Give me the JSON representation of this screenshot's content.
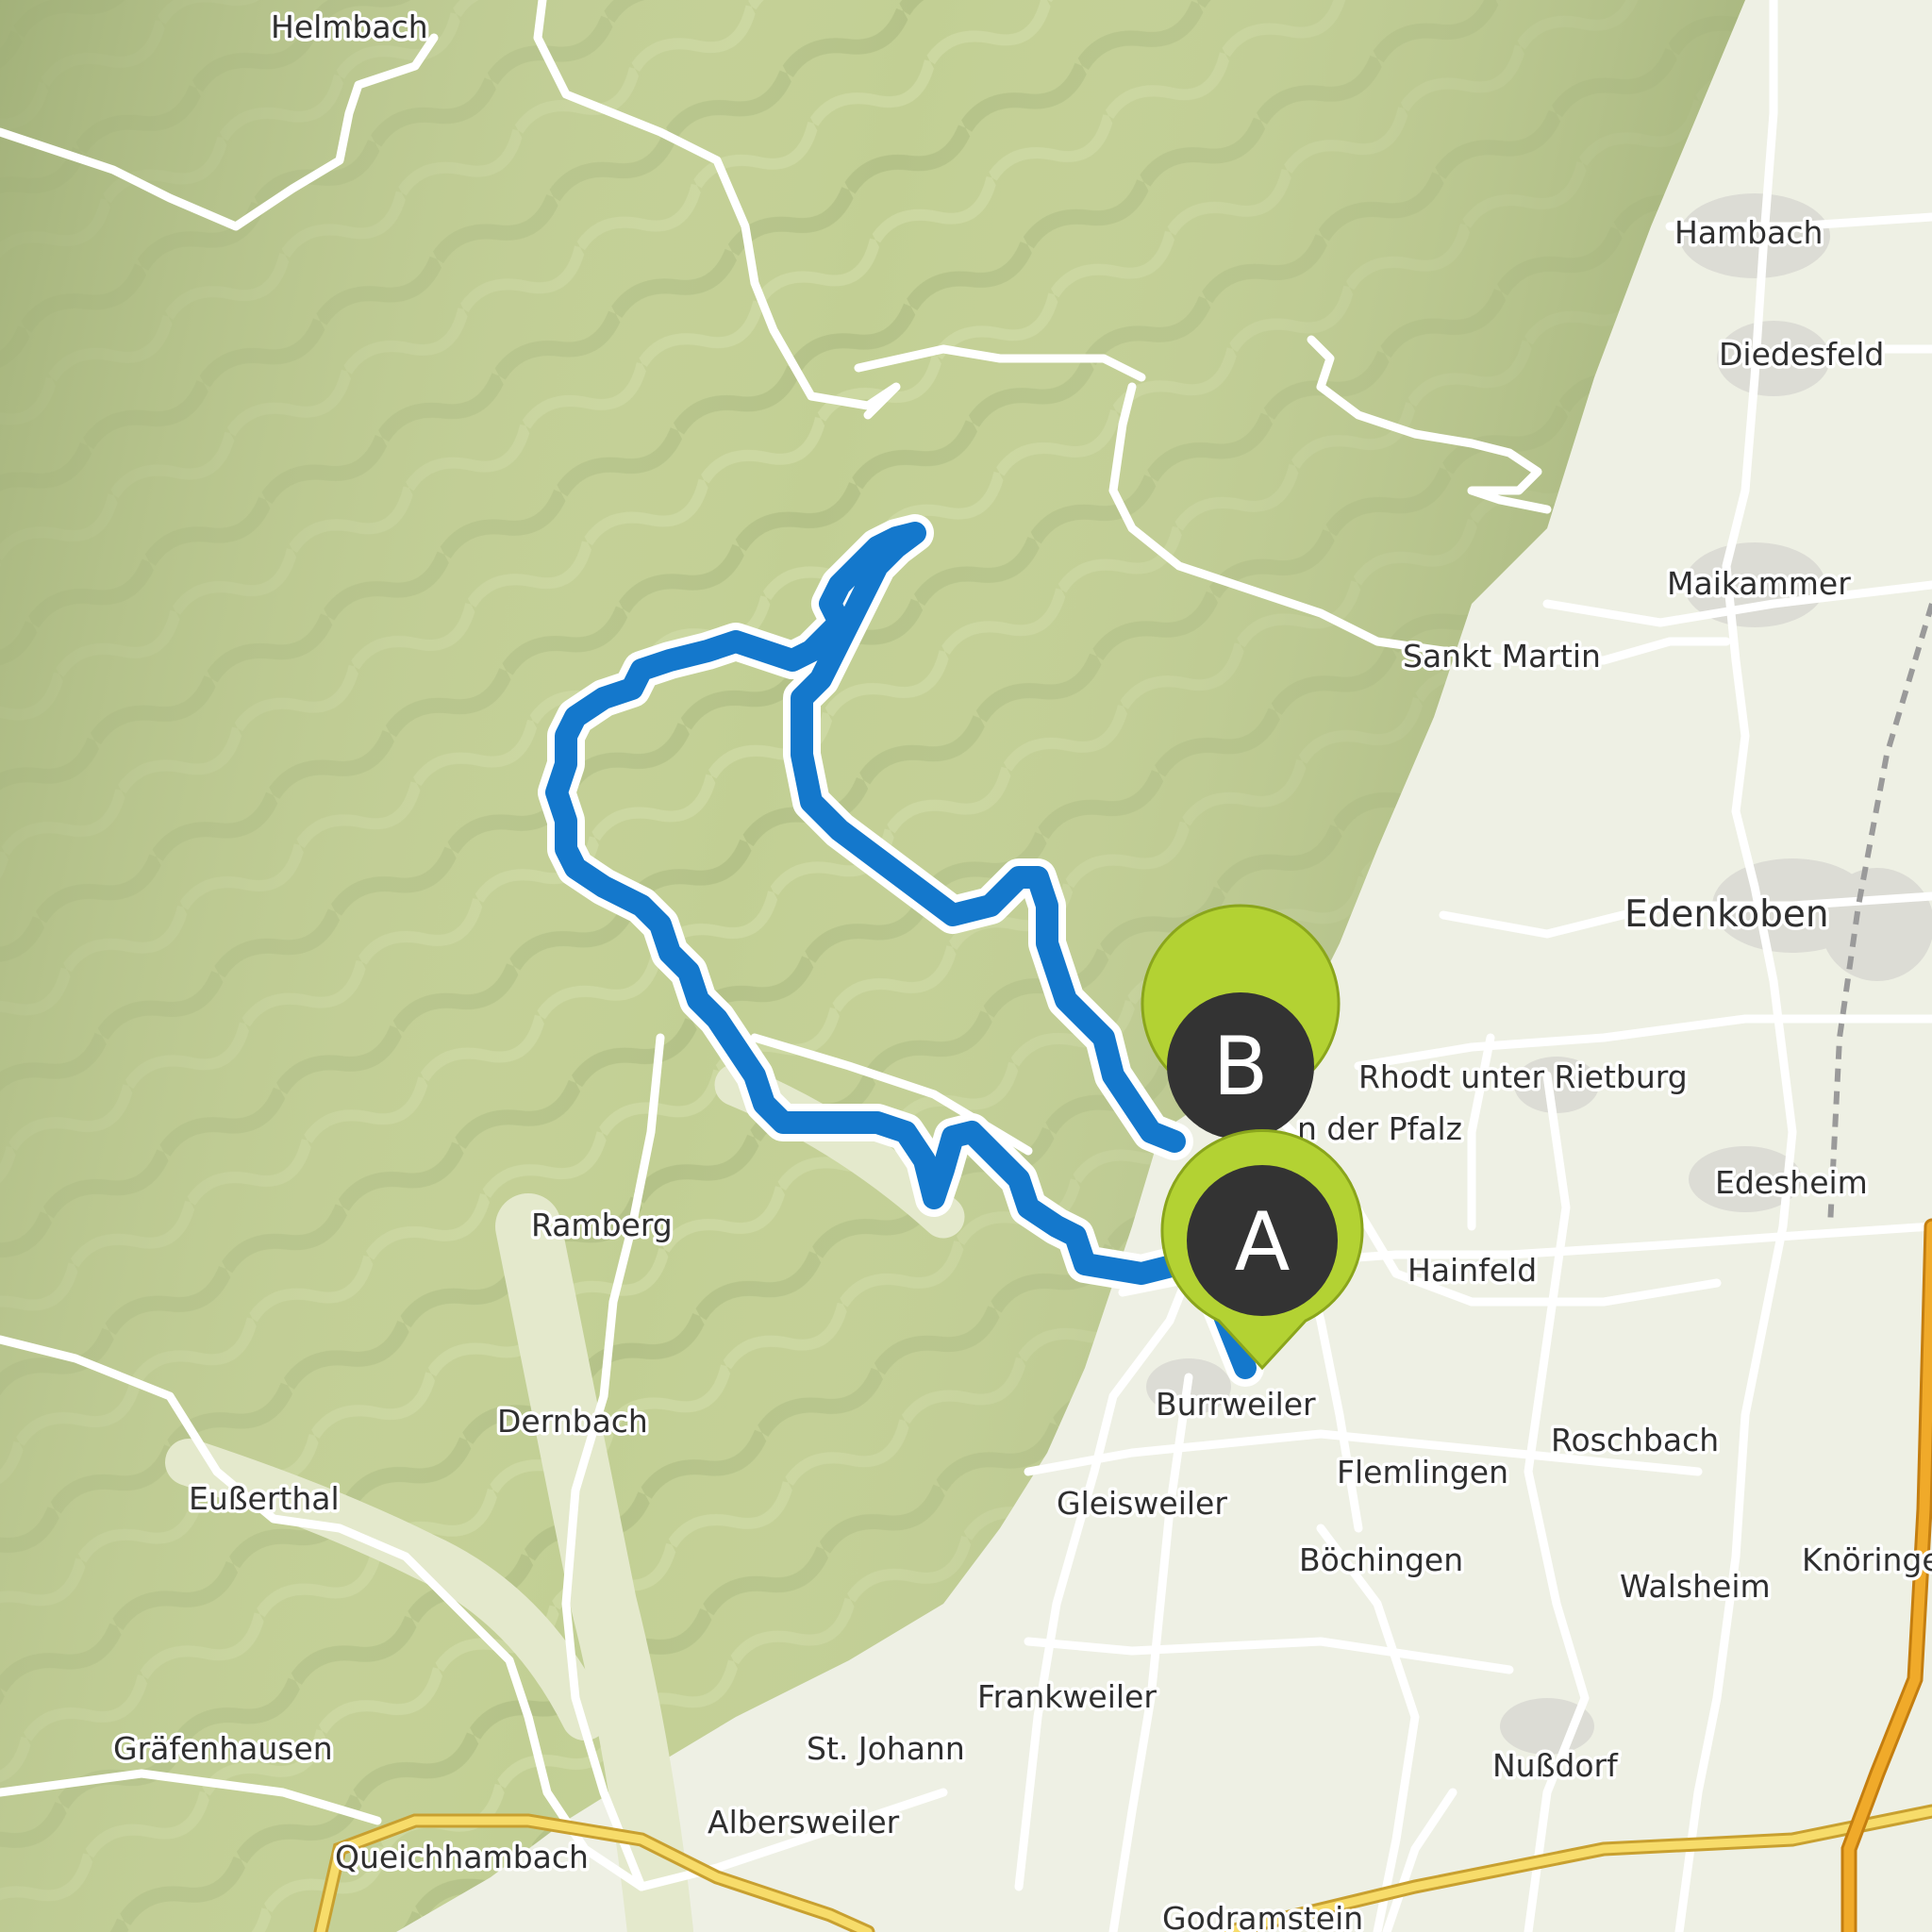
{
  "map": {
    "type": "topographic route map",
    "colors": {
      "hills": "#c2cf94",
      "hills_shadow": "#a1b07a",
      "plain": "#eef0e4",
      "route": "#1478cc",
      "route_halo": "#ffffff",
      "marker_fill": "#333333",
      "marker_ring": "#b3d233",
      "motorway": "#f0aa2a",
      "trunk_road": "#f7dc6a"
    },
    "places": {
      "helmbach": "Helmbach",
      "hambach": "Hambach",
      "diedesfeld": "Diedesfeld",
      "maikammer": "Maikammer",
      "sankt_martin": "Sankt Martin",
      "edenkoben": "Edenkoben",
      "rhodt": "Rhodt unter Rietburg",
      "weyher_partial": "n der Pfalz",
      "edesheim": "Edesheim",
      "hainfeld": "Hainfeld",
      "ramberg": "Ramberg",
      "dernbach": "Dernbach",
      "burrweiler": "Burrweiler",
      "roschbach": "Roschbach",
      "flemlingen": "Flemlingen",
      "gleisweiler": "Gleisweiler",
      "eusserthal": "Eußerthal",
      "boechingen": "Böchingen",
      "walsheim": "Walsheim",
      "knoeringen_partial": "Knöringe",
      "frankweiler": "Frankweiler",
      "st_johann": "St. Johann",
      "graefenhausen": "Gräfenhausen",
      "nussdorf": "Nußdorf",
      "albersweiler": "Albersweiler",
      "queichhambach": "Queichhambach",
      "godramstein": "Godramstein"
    },
    "markers": {
      "start": {
        "letter": "A",
        "icon": "start-pin-icon"
      },
      "end": {
        "letter": "B",
        "icon": "end-pin-icon"
      }
    }
  }
}
